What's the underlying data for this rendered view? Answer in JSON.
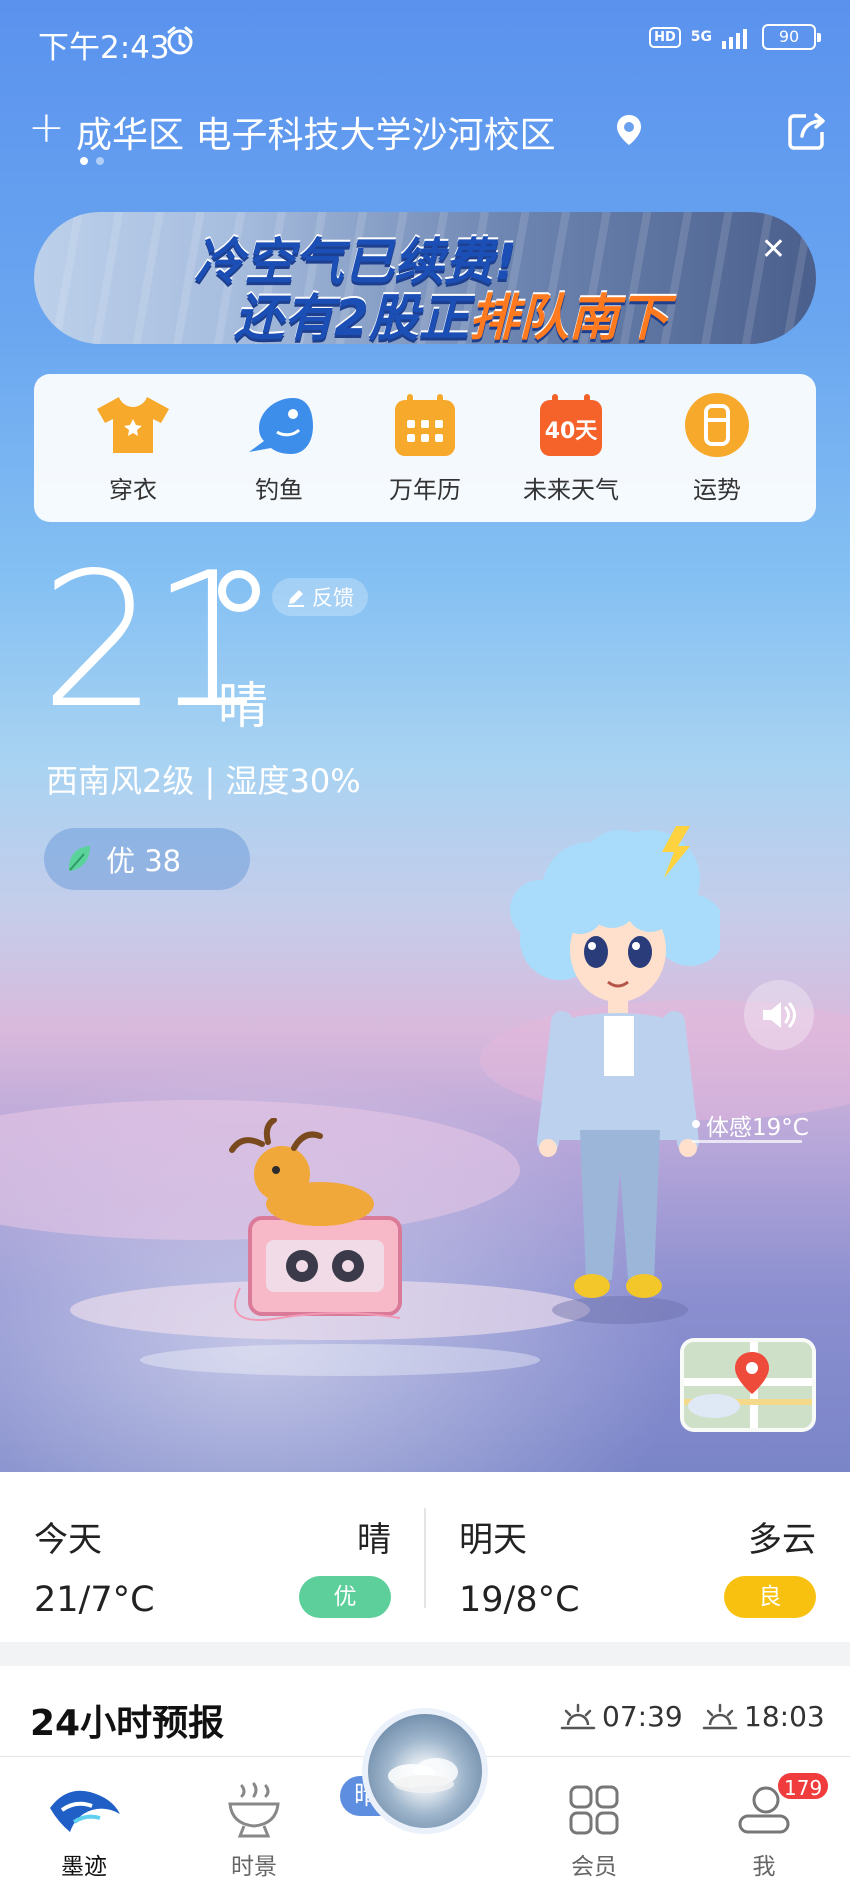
{
  "status_bar": {
    "time": "下午2:43",
    "hd": "HD",
    "network": "5G",
    "battery": "90"
  },
  "location": {
    "text": "成华区 电子科技大学沙河校区"
  },
  "banner": {
    "line1": "冷空气已续费!",
    "line2_part1": "还有2股正",
    "line2_part2": "排队南下"
  },
  "quick_actions": [
    {
      "label": "穿衣",
      "icon": "tshirt-icon"
    },
    {
      "label": "钓鱼",
      "icon": "fish-icon"
    },
    {
      "label": "万年历",
      "icon": "calendar-icon"
    },
    {
      "label": "未来天气",
      "icon": "forecast-40-days-icon",
      "icon_text": "40天"
    },
    {
      "label": "运势",
      "icon": "fortune-icon"
    }
  ],
  "current": {
    "temp": "21",
    "condition": "晴",
    "feedback_label": "反馈",
    "wind_humidity": "西南风2级 | 湿度30%",
    "aqi": "优 38",
    "feels_like": "体感19°C"
  },
  "days": [
    {
      "name": "今天",
      "condition": "晴",
      "range": "21/7°C",
      "aqi": "优",
      "aqi_color": "#5ccf9a"
    },
    {
      "name": "明天",
      "condition": "多云",
      "range": "19/8°C",
      "aqi": "良",
      "aqi_color": "#f8c10f"
    }
  ],
  "hourly": {
    "title": "24小时预报",
    "sunrise": "07:39",
    "sunset": "18:03"
  },
  "tabbar": {
    "center_label": "晴",
    "tabs": [
      {
        "label": "墨迹",
        "icon": "moji-logo-icon"
      },
      {
        "label": "时景",
        "icon": "scenery-icon"
      },
      {
        "label": "会员",
        "icon": "member-grid-icon"
      },
      {
        "label": "我",
        "icon": "profile-icon",
        "badge": "179"
      }
    ]
  }
}
